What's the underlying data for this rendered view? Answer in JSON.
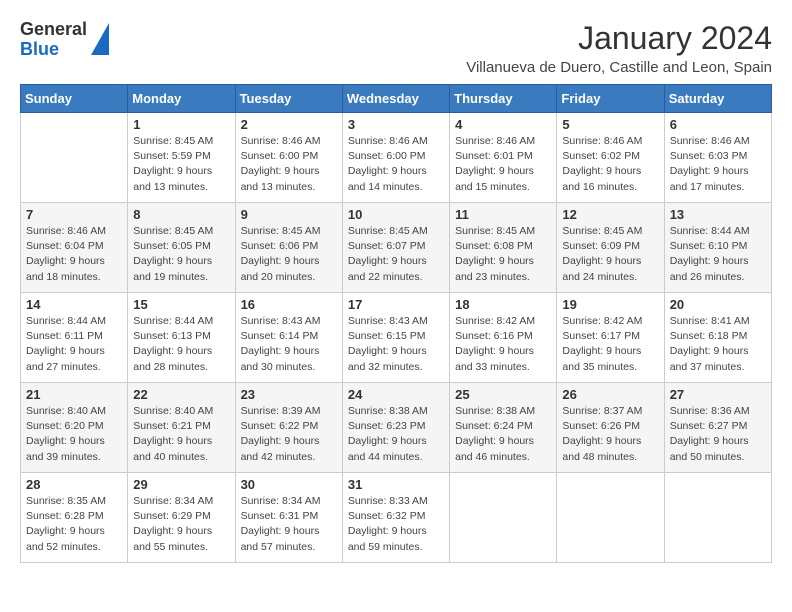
{
  "logo": {
    "general": "General",
    "blue": "Blue"
  },
  "title": "January 2024",
  "location": "Villanueva de Duero, Castille and Leon, Spain",
  "days_of_week": [
    "Sunday",
    "Monday",
    "Tuesday",
    "Wednesday",
    "Thursday",
    "Friday",
    "Saturday"
  ],
  "weeks": [
    [
      {
        "day": "",
        "sunrise": "",
        "sunset": "",
        "daylight": ""
      },
      {
        "day": "1",
        "sunrise": "Sunrise: 8:45 AM",
        "sunset": "Sunset: 5:59 PM",
        "daylight": "Daylight: 9 hours and 13 minutes."
      },
      {
        "day": "2",
        "sunrise": "Sunrise: 8:46 AM",
        "sunset": "Sunset: 6:00 PM",
        "daylight": "Daylight: 9 hours and 13 minutes."
      },
      {
        "day": "3",
        "sunrise": "Sunrise: 8:46 AM",
        "sunset": "Sunset: 6:00 PM",
        "daylight": "Daylight: 9 hours and 14 minutes."
      },
      {
        "day": "4",
        "sunrise": "Sunrise: 8:46 AM",
        "sunset": "Sunset: 6:01 PM",
        "daylight": "Daylight: 9 hours and 15 minutes."
      },
      {
        "day": "5",
        "sunrise": "Sunrise: 8:46 AM",
        "sunset": "Sunset: 6:02 PM",
        "daylight": "Daylight: 9 hours and 16 minutes."
      },
      {
        "day": "6",
        "sunrise": "Sunrise: 8:46 AM",
        "sunset": "Sunset: 6:03 PM",
        "daylight": "Daylight: 9 hours and 17 minutes."
      }
    ],
    [
      {
        "day": "7",
        "sunrise": "Sunrise: 8:46 AM",
        "sunset": "Sunset: 6:04 PM",
        "daylight": "Daylight: 9 hours and 18 minutes."
      },
      {
        "day": "8",
        "sunrise": "Sunrise: 8:45 AM",
        "sunset": "Sunset: 6:05 PM",
        "daylight": "Daylight: 9 hours and 19 minutes."
      },
      {
        "day": "9",
        "sunrise": "Sunrise: 8:45 AM",
        "sunset": "Sunset: 6:06 PM",
        "daylight": "Daylight: 9 hours and 20 minutes."
      },
      {
        "day": "10",
        "sunrise": "Sunrise: 8:45 AM",
        "sunset": "Sunset: 6:07 PM",
        "daylight": "Daylight: 9 hours and 22 minutes."
      },
      {
        "day": "11",
        "sunrise": "Sunrise: 8:45 AM",
        "sunset": "Sunset: 6:08 PM",
        "daylight": "Daylight: 9 hours and 23 minutes."
      },
      {
        "day": "12",
        "sunrise": "Sunrise: 8:45 AM",
        "sunset": "Sunset: 6:09 PM",
        "daylight": "Daylight: 9 hours and 24 minutes."
      },
      {
        "day": "13",
        "sunrise": "Sunrise: 8:44 AM",
        "sunset": "Sunset: 6:10 PM",
        "daylight": "Daylight: 9 hours and 26 minutes."
      }
    ],
    [
      {
        "day": "14",
        "sunrise": "Sunrise: 8:44 AM",
        "sunset": "Sunset: 6:11 PM",
        "daylight": "Daylight: 9 hours and 27 minutes."
      },
      {
        "day": "15",
        "sunrise": "Sunrise: 8:44 AM",
        "sunset": "Sunset: 6:13 PM",
        "daylight": "Daylight: 9 hours and 28 minutes."
      },
      {
        "day": "16",
        "sunrise": "Sunrise: 8:43 AM",
        "sunset": "Sunset: 6:14 PM",
        "daylight": "Daylight: 9 hours and 30 minutes."
      },
      {
        "day": "17",
        "sunrise": "Sunrise: 8:43 AM",
        "sunset": "Sunset: 6:15 PM",
        "daylight": "Daylight: 9 hours and 32 minutes."
      },
      {
        "day": "18",
        "sunrise": "Sunrise: 8:42 AM",
        "sunset": "Sunset: 6:16 PM",
        "daylight": "Daylight: 9 hours and 33 minutes."
      },
      {
        "day": "19",
        "sunrise": "Sunrise: 8:42 AM",
        "sunset": "Sunset: 6:17 PM",
        "daylight": "Daylight: 9 hours and 35 minutes."
      },
      {
        "day": "20",
        "sunrise": "Sunrise: 8:41 AM",
        "sunset": "Sunset: 6:18 PM",
        "daylight": "Daylight: 9 hours and 37 minutes."
      }
    ],
    [
      {
        "day": "21",
        "sunrise": "Sunrise: 8:40 AM",
        "sunset": "Sunset: 6:20 PM",
        "daylight": "Daylight: 9 hours and 39 minutes."
      },
      {
        "day": "22",
        "sunrise": "Sunrise: 8:40 AM",
        "sunset": "Sunset: 6:21 PM",
        "daylight": "Daylight: 9 hours and 40 minutes."
      },
      {
        "day": "23",
        "sunrise": "Sunrise: 8:39 AM",
        "sunset": "Sunset: 6:22 PM",
        "daylight": "Daylight: 9 hours and 42 minutes."
      },
      {
        "day": "24",
        "sunrise": "Sunrise: 8:38 AM",
        "sunset": "Sunset: 6:23 PM",
        "daylight": "Daylight: 9 hours and 44 minutes."
      },
      {
        "day": "25",
        "sunrise": "Sunrise: 8:38 AM",
        "sunset": "Sunset: 6:24 PM",
        "daylight": "Daylight: 9 hours and 46 minutes."
      },
      {
        "day": "26",
        "sunrise": "Sunrise: 8:37 AM",
        "sunset": "Sunset: 6:26 PM",
        "daylight": "Daylight: 9 hours and 48 minutes."
      },
      {
        "day": "27",
        "sunrise": "Sunrise: 8:36 AM",
        "sunset": "Sunset: 6:27 PM",
        "daylight": "Daylight: 9 hours and 50 minutes."
      }
    ],
    [
      {
        "day": "28",
        "sunrise": "Sunrise: 8:35 AM",
        "sunset": "Sunset: 6:28 PM",
        "daylight": "Daylight: 9 hours and 52 minutes."
      },
      {
        "day": "29",
        "sunrise": "Sunrise: 8:34 AM",
        "sunset": "Sunset: 6:29 PM",
        "daylight": "Daylight: 9 hours and 55 minutes."
      },
      {
        "day": "30",
        "sunrise": "Sunrise: 8:34 AM",
        "sunset": "Sunset: 6:31 PM",
        "daylight": "Daylight: 9 hours and 57 minutes."
      },
      {
        "day": "31",
        "sunrise": "Sunrise: 8:33 AM",
        "sunset": "Sunset: 6:32 PM",
        "daylight": "Daylight: 9 hours and 59 minutes."
      },
      {
        "day": "",
        "sunrise": "",
        "sunset": "",
        "daylight": ""
      },
      {
        "day": "",
        "sunrise": "",
        "sunset": "",
        "daylight": ""
      },
      {
        "day": "",
        "sunrise": "",
        "sunset": "",
        "daylight": ""
      }
    ]
  ]
}
